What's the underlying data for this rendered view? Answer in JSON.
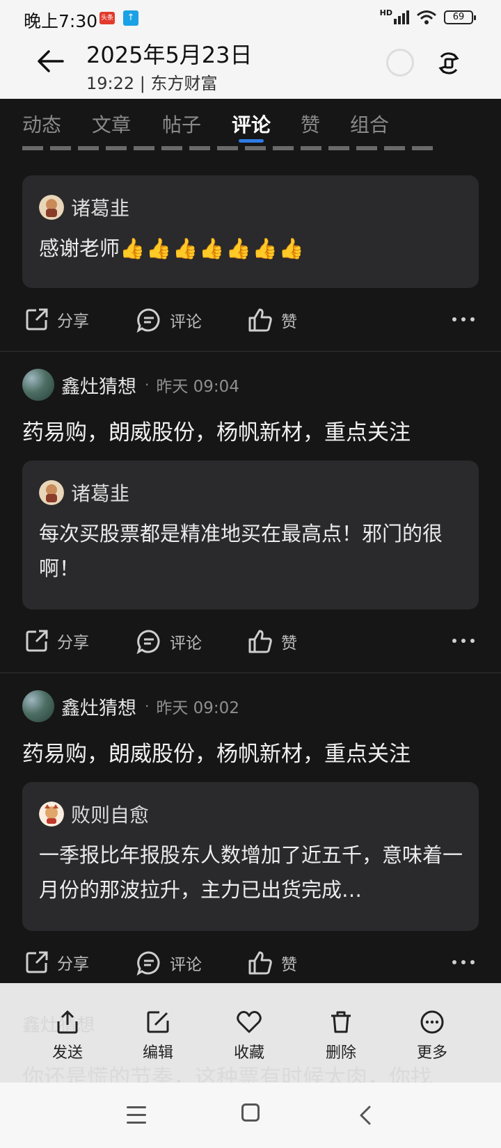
{
  "status_bar": {
    "time": "晚上7:30",
    "badge_red": "头条",
    "badge_blue": "↑",
    "network": "HD",
    "battery": "69"
  },
  "header": {
    "title": "2025年5月23日",
    "subtitle": "19:22 | 东方财富"
  },
  "tabs": [
    {
      "label": "动态"
    },
    {
      "label": "文章"
    },
    {
      "label": "帖子"
    },
    {
      "label": "评论",
      "active": true
    },
    {
      "label": "赞"
    },
    {
      "label": "组合"
    }
  ],
  "accent_color": "#2e7ae6",
  "actions": {
    "share": "分享",
    "comment": "评论",
    "like": "赞"
  },
  "items": [
    {
      "quote": {
        "name": "诸葛韭",
        "text": "感谢老师",
        "emoji": "👍👍👍👍👍👍👍"
      }
    },
    {
      "poster": "鑫灶猜想",
      "time": "昨天 09:04",
      "text": "药易购，朗威股份，杨帆新材，重点关注",
      "quote": {
        "name": "诸葛韭",
        "text": "每次买股票都是精准地买在最高点！邪门的很啊！"
      }
    },
    {
      "poster": "鑫灶猜想",
      "time": "昨天 09:02",
      "text": "药易购，朗威股份，杨帆新材，重点关注",
      "quote": {
        "name": "败则自愈",
        "text": "一季报比年报股东人数增加了近五千，意味着一月份的那波拉升，主力已出货完成…"
      }
    }
  ],
  "bottom_sheet": {
    "behind_name": "鑫灶猜想",
    "behind_text": "你还是慌的节奏，这种票有时候太肉，你找",
    "buttons": [
      {
        "label": "发送",
        "icon": "send-icon"
      },
      {
        "label": "编辑",
        "icon": "edit-icon"
      },
      {
        "label": "收藏",
        "icon": "heart-icon"
      },
      {
        "label": "删除",
        "icon": "trash-icon"
      },
      {
        "label": "更多",
        "icon": "more-icon"
      }
    ]
  }
}
